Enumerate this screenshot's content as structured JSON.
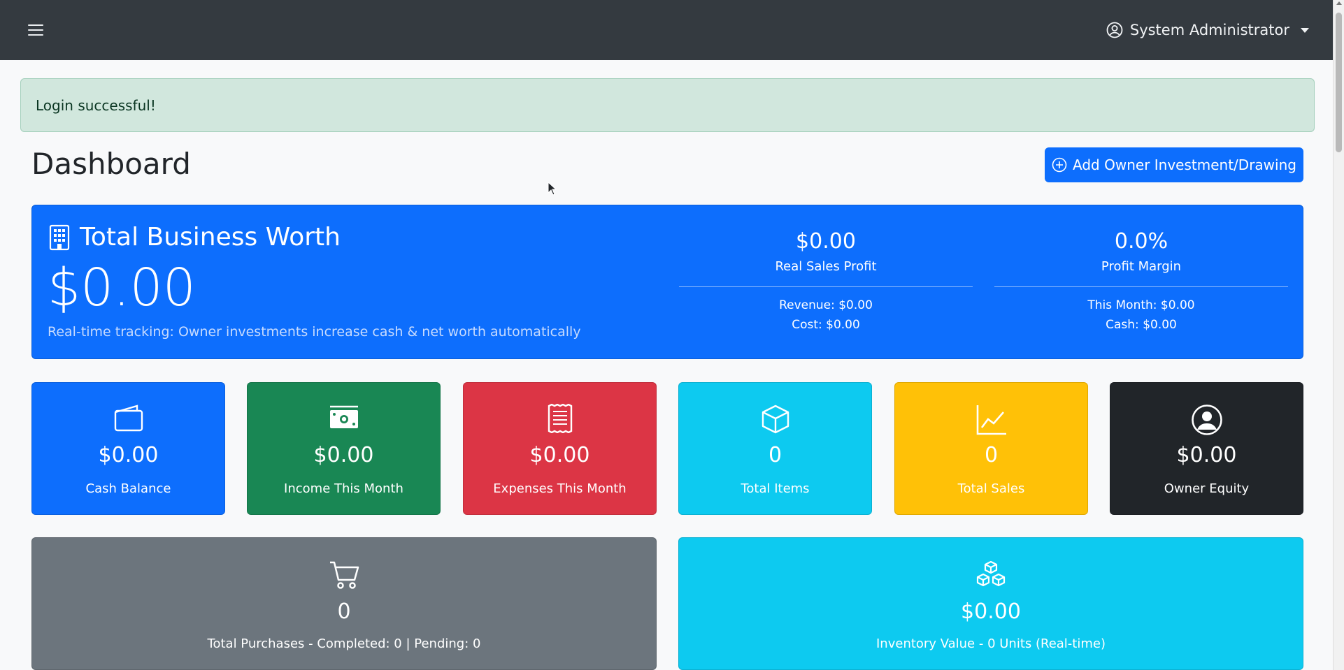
{
  "navbar": {
    "user_name": "System Administrator",
    "menu_icon": "hamburger-icon",
    "user_icon": "person-circle-icon"
  },
  "alert": {
    "message": "Login successful!"
  },
  "header": {
    "title": "Dashboard",
    "add_button_label": "Add Owner Investment/Drawing"
  },
  "worth": {
    "title": "Total Business Worth",
    "value": "$0.00",
    "note": "Real-time tracking: Owner investments increase cash & net worth automatically",
    "profit": {
      "value": "$0.00",
      "label": "Real Sales Profit",
      "revenue": "Revenue: $0.00",
      "cost": "Cost: $0.00"
    },
    "margin": {
      "value": "0.0%",
      "label": "Profit Margin",
      "this_month": "This Month: $0.00",
      "cash": "Cash: $0.00"
    }
  },
  "cards": [
    {
      "value": "$0.00",
      "label": "Cash Balance",
      "color": "#0d6efd",
      "icon": "wallet-icon"
    },
    {
      "value": "$0.00",
      "label": "Income This Month",
      "color": "#198754",
      "icon": "cash-icon"
    },
    {
      "value": "$0.00",
      "label": "Expenses This Month",
      "color": "#dc3545",
      "icon": "receipt-icon"
    },
    {
      "value": "0",
      "label": "Total Items",
      "color": "#0dcaf0",
      "icon": "box-icon"
    },
    {
      "value": "0",
      "label": "Total Sales",
      "color": "#ffc107",
      "icon": "graph-up-icon"
    },
    {
      "value": "$0.00",
      "label": "Owner Equity",
      "color": "#212529",
      "icon": "person-circle-icon"
    }
  ],
  "wide_cards": [
    {
      "value": "0",
      "label": "Total Purchases - Completed: 0 | Pending: 0",
      "color": "#6c757d",
      "icon": "cart-icon"
    },
    {
      "value": "$0.00",
      "label": "Inventory Value - 0 Units (Real-time)",
      "color": "#0dcaf0",
      "icon": "boxes-icon"
    }
  ]
}
